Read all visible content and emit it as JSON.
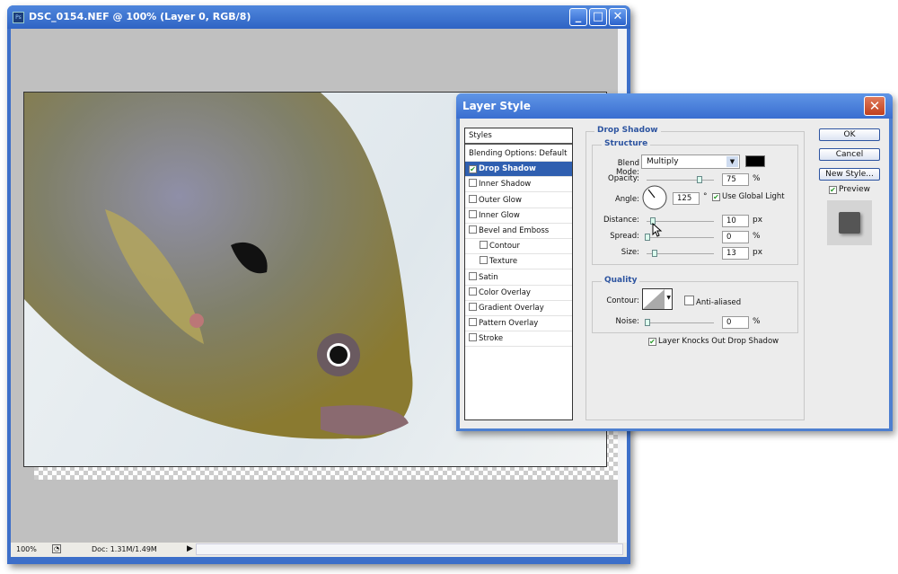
{
  "document": {
    "title": "DSC_0154.NEF @ 100% (Layer 0, RGB/8)",
    "app_icon": "Ps",
    "zoom": "100%",
    "doc_size": "Doc: 1.31M/1.49M"
  },
  "dialog": {
    "title": "Layer Style",
    "styles_header": "Styles",
    "styles": [
      {
        "label": "Blending Options: Default",
        "checkbox": false,
        "checked": false,
        "indent": false,
        "selected": false
      },
      {
        "label": "Drop Shadow",
        "checkbox": true,
        "checked": true,
        "indent": false,
        "selected": true
      },
      {
        "label": "Inner Shadow",
        "checkbox": true,
        "checked": false,
        "indent": false,
        "selected": false
      },
      {
        "label": "Outer Glow",
        "checkbox": true,
        "checked": false,
        "indent": false,
        "selected": false
      },
      {
        "label": "Inner Glow",
        "checkbox": true,
        "checked": false,
        "indent": false,
        "selected": false
      },
      {
        "label": "Bevel and Emboss",
        "checkbox": true,
        "checked": false,
        "indent": false,
        "selected": false
      },
      {
        "label": "Contour",
        "checkbox": true,
        "checked": false,
        "indent": true,
        "selected": false
      },
      {
        "label": "Texture",
        "checkbox": true,
        "checked": false,
        "indent": true,
        "selected": false
      },
      {
        "label": "Satin",
        "checkbox": true,
        "checked": false,
        "indent": false,
        "selected": false
      },
      {
        "label": "Color Overlay",
        "checkbox": true,
        "checked": false,
        "indent": false,
        "selected": false
      },
      {
        "label": "Gradient Overlay",
        "checkbox": true,
        "checked": false,
        "indent": false,
        "selected": false
      },
      {
        "label": "Pattern Overlay",
        "checkbox": true,
        "checked": false,
        "indent": false,
        "selected": false
      },
      {
        "label": "Stroke",
        "checkbox": true,
        "checked": false,
        "indent": false,
        "selected": false
      }
    ],
    "section": "Drop Shadow",
    "structure": {
      "title": "Structure",
      "blend_mode_label": "Blend Mode:",
      "blend_mode": "Multiply",
      "shadow_color": "#000000",
      "opacity_label": "Opacity:",
      "opacity": "75",
      "opacity_unit": "%",
      "angle_label": "Angle:",
      "angle": "125",
      "angle_unit": "°",
      "use_global_light": "Use Global Light",
      "use_global_light_checked": true,
      "distance_label": "Distance:",
      "distance": "10",
      "distance_unit": "px",
      "spread_label": "Spread:",
      "spread": "0",
      "spread_unit": "%",
      "size_label": "Size:",
      "size": "13",
      "size_unit": "px"
    },
    "quality": {
      "title": "Quality",
      "contour_label": "Contour:",
      "anti_aliased": "Anti-aliased",
      "anti_aliased_checked": false,
      "noise_label": "Noise:",
      "noise": "0",
      "noise_unit": "%"
    },
    "knockout": "Layer Knocks Out Drop Shadow",
    "knockout_checked": true,
    "buttons": {
      "ok": "OK",
      "cancel": "Cancel",
      "new_style": "New Style..."
    },
    "preview": "Preview",
    "preview_checked": true
  }
}
